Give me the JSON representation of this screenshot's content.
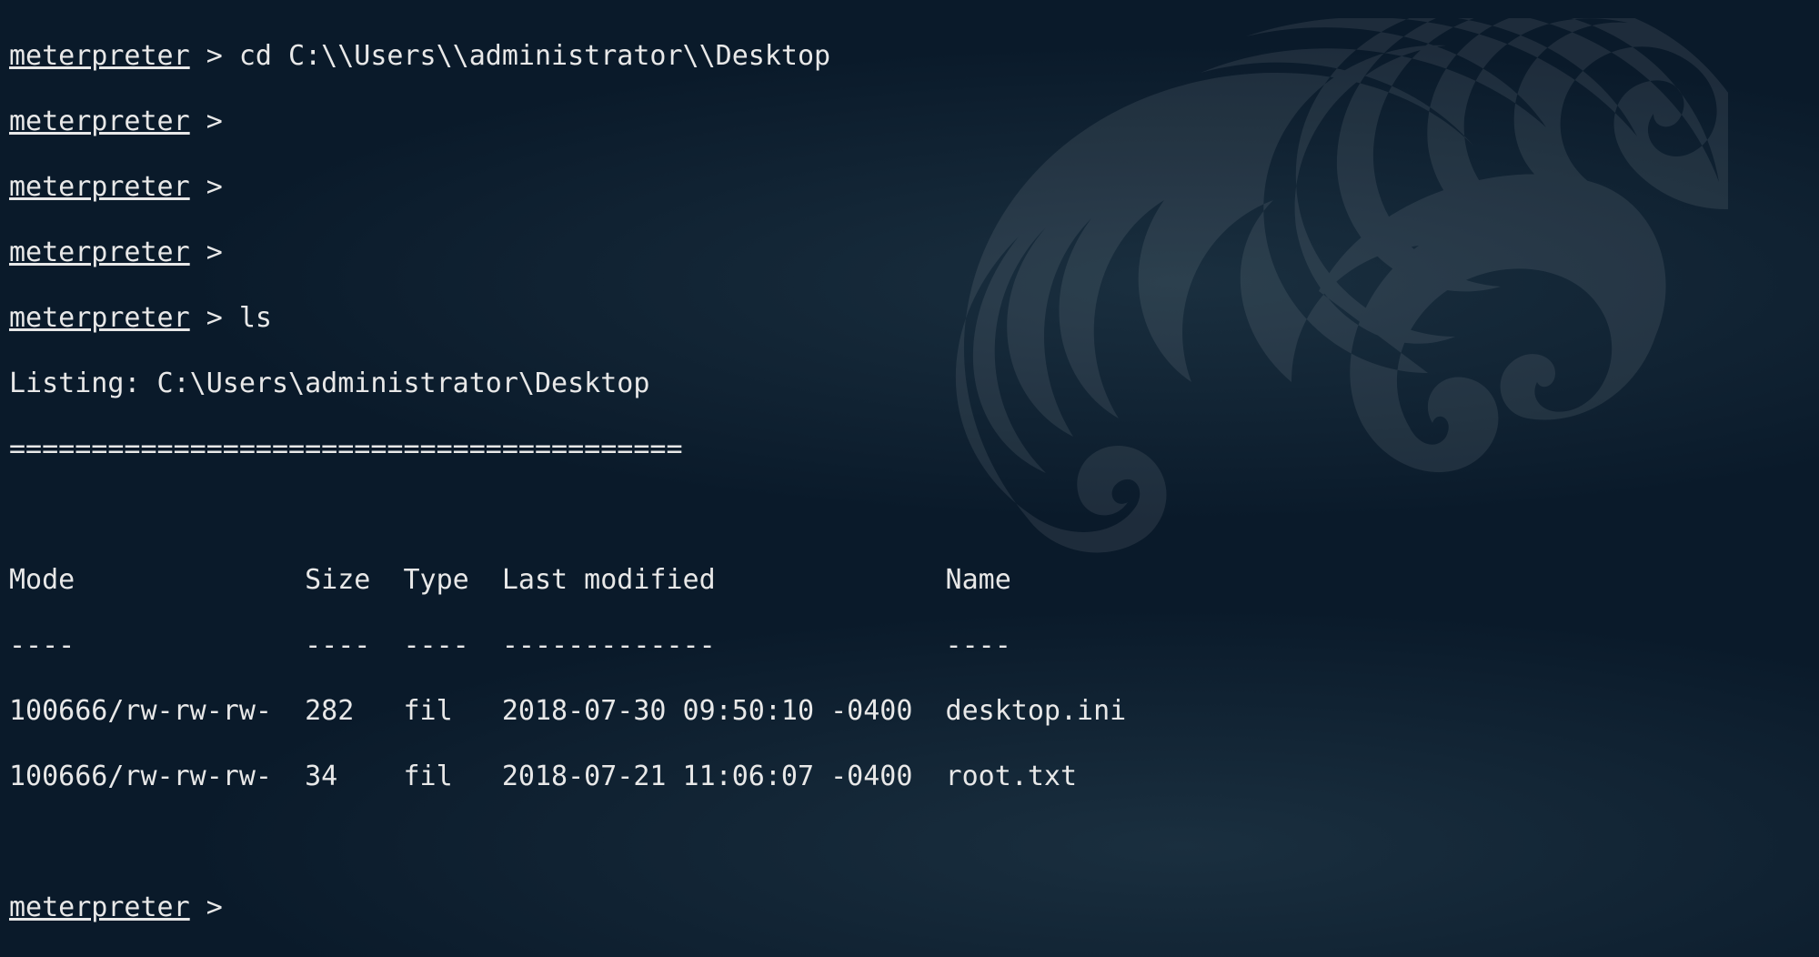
{
  "terminal": {
    "prompt": "meterpreter",
    "separator": " > ",
    "lines": [
      {
        "cmd": "cd C:\\\\Users\\\\administrator\\\\Desktop"
      },
      {
        "cmd": ""
      },
      {
        "cmd": ""
      },
      {
        "cmd": ""
      },
      {
        "cmd": "ls"
      }
    ],
    "listing_header": "Listing: C:\\Users\\administrator\\Desktop",
    "listing_divider": "=========================================",
    "columns": {
      "mode": "Mode",
      "size": "Size",
      "type": "Type",
      "modified": "Last modified",
      "name": "Name"
    },
    "column_dashes": {
      "mode": "----",
      "size": "----",
      "type": "----",
      "modified": "-------------",
      "name": "----"
    },
    "rows": [
      {
        "mode": "100666/rw-rw-rw-",
        "size": "282",
        "type": "fil",
        "modified": "2018-07-30 09:50:10 -0400",
        "name": "desktop.ini"
      },
      {
        "mode": "100666/rw-rw-rw-",
        "size": "34",
        "type": "fil",
        "modified": "2018-07-21 11:06:07 -0400",
        "name": "root.txt"
      }
    ],
    "final_prompt": true
  }
}
